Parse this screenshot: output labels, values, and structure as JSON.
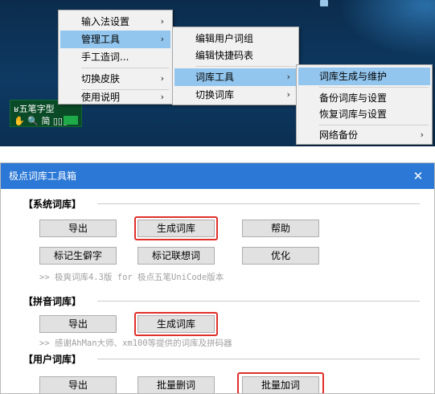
{
  "menus": {
    "level1": [
      {
        "label": "输入法设置",
        "arrow": "›"
      },
      {
        "label": "管理工具",
        "arrow": "›"
      },
      {
        "label": "手工造词..."
      },
      {
        "label": "切换皮肤",
        "arrow": "›"
      },
      {
        "label": "使用说明",
        "arrow": "›"
      }
    ],
    "level2": [
      {
        "label": "编辑用户词组"
      },
      {
        "label": "编辑快捷码表"
      },
      {
        "label": "词库工具",
        "arrow": "›"
      },
      {
        "label": "切换词库",
        "arrow": "›"
      }
    ],
    "level3": [
      {
        "label": "词库生成与维护"
      },
      {
        "label": "备份词库与设置"
      },
      {
        "label": "恢复词库与设置"
      },
      {
        "label": "网络备份",
        "arrow": "›"
      }
    ]
  },
  "ime_status": {
    "line1": "ʁ五笔字型",
    "line2": "✋ 🔍 简 ▯▯▯"
  },
  "dialog": {
    "title": "极点词库工具箱",
    "close": "✕",
    "sections": {
      "system": {
        "header": "【系统词库】",
        "buttons": [
          "导出",
          "生成词库",
          "帮助",
          "标记生僻字",
          "标记联想词",
          "优化"
        ],
        "note": ">> 极爽词库4.3版 for 极点五笔UniCode版本"
      },
      "pinyin": {
        "header": "【拼音词库】",
        "buttons": [
          "导出",
          "生成词库"
        ],
        "note": ">> 感谢AhMan大师、xm100等提供的词库及拼码器"
      },
      "user": {
        "header": "【用户词库】",
        "buttons": [
          "导出",
          "批量删词",
          "批量加词"
        ]
      }
    }
  }
}
